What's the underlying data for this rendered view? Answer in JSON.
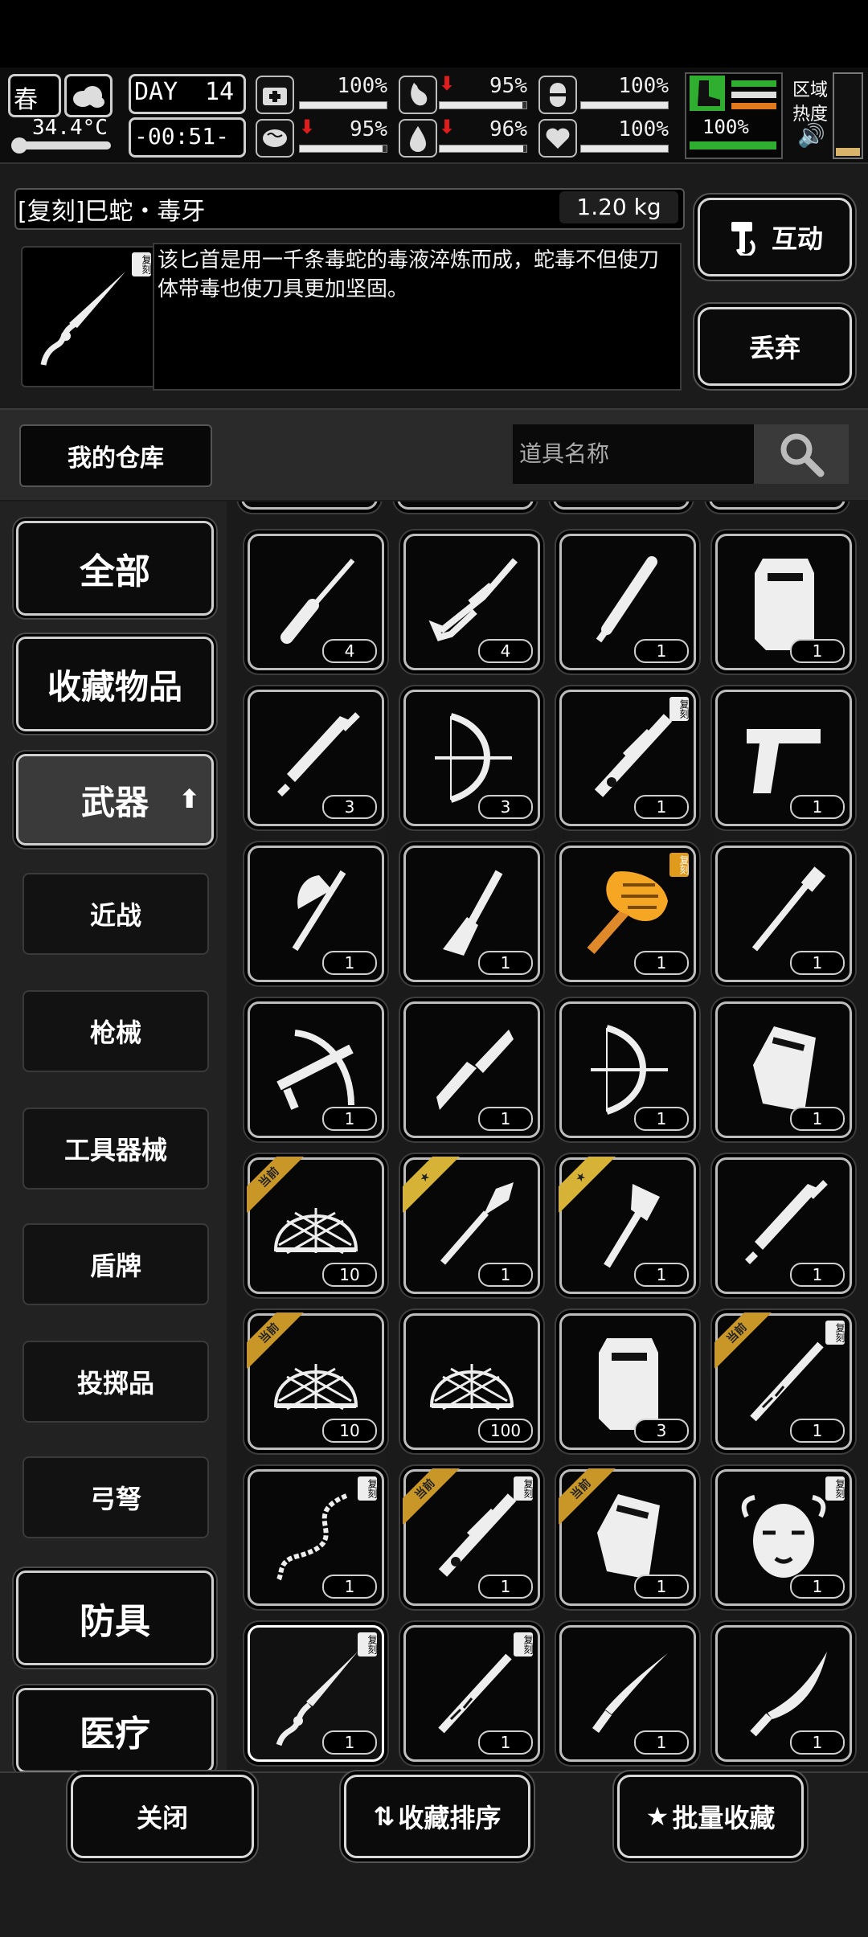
{
  "hud": {
    "season": "春",
    "temperature": "34.4°C",
    "day_label": "DAY",
    "day_number": "14",
    "clock": "-00:51-",
    "zone_heat_label_1": "区域",
    "zone_heat_label_2": "热度",
    "stats": [
      {
        "icon": "medkit-icon",
        "value": "100%",
        "level": 1.0,
        "down": false
      },
      {
        "icon": "stomach-icon",
        "value": "95%",
        "level": 0.95,
        "down": true
      },
      {
        "icon": "pill-icon",
        "value": "100%",
        "level": 1.0,
        "down": false
      },
      {
        "icon": "brain-icon",
        "value": "95%",
        "level": 0.95,
        "down": true
      },
      {
        "icon": "water-drop-icon",
        "value": "96%",
        "level": 0.96,
        "down": true
      },
      {
        "icon": "heart-icon",
        "value": "100%",
        "level": 1.0,
        "down": false
      }
    ],
    "stamina_value": "100%"
  },
  "item": {
    "title": "[复刻]巳蛇・毒牙",
    "weight": "1.20 kg",
    "tag": "复刻",
    "description": "该匕首是用一千条毒蛇的毒液淬炼而成，蛇毒不但使刀体带毒也使刀具更加坚固。"
  },
  "actions": {
    "interact": "互动",
    "discard": "丢弃"
  },
  "warehouse": {
    "tab_label": "我的仓库",
    "search_placeholder": "道具名称"
  },
  "sidebar": {
    "all": "全部",
    "favorites": "收藏物品",
    "weapons": "武器",
    "sub": [
      "近战",
      "枪械",
      "工具器械",
      "盾牌",
      "投掷品",
      "弓弩"
    ],
    "armor": "防具",
    "medical": "医疗"
  },
  "grid": [
    {
      "icon": "screwdriver-icon",
      "count": "4"
    },
    {
      "icon": "sniper-rifle-icon",
      "count": "4"
    },
    {
      "icon": "baton-icon",
      "count": "1"
    },
    {
      "icon": "riot-shield-icon",
      "count": "1"
    },
    {
      "icon": "broadsword-icon",
      "count": "3"
    },
    {
      "icon": "compound-bow-icon",
      "count": "3"
    },
    {
      "icon": "ornate-rifle-icon",
      "count": "1",
      "tag": "复刻"
    },
    {
      "icon": "pistol-icon",
      "count": "1"
    },
    {
      "icon": "axe-icon",
      "count": "1"
    },
    {
      "icon": "spatula-icon",
      "count": "1"
    },
    {
      "icon": "golden-mace-icon",
      "count": "1",
      "tag": "复刻",
      "tag_gold": true
    },
    {
      "icon": "telescopic-baton-icon",
      "count": "1"
    },
    {
      "icon": "crossbow-icon",
      "count": "1"
    },
    {
      "icon": "combat-knife-icon",
      "count": "1"
    },
    {
      "icon": "compound-bow-icon",
      "count": "1"
    },
    {
      "icon": "armored-shield-icon",
      "count": "1"
    },
    {
      "icon": "net-icon",
      "count": "10",
      "ribbon": "当前"
    },
    {
      "icon": "shovel-icon",
      "count": "1",
      "ribbon_star": true
    },
    {
      "icon": "hatchet-icon",
      "count": "1",
      "ribbon_star": true
    },
    {
      "icon": "broadsword-icon",
      "count": "1"
    },
    {
      "icon": "net-icon",
      "count": "10",
      "ribbon": "当前"
    },
    {
      "icon": "net-icon",
      "count": "100"
    },
    {
      "icon": "riot-shield-icon",
      "count": "3"
    },
    {
      "icon": "ornate-sword-icon",
      "count": "1",
      "tag": "复刻",
      "ribbon": "当前"
    },
    {
      "icon": "chain-whip-icon",
      "count": "1",
      "tag": "复刻"
    },
    {
      "icon": "ornate-rifle-icon",
      "count": "1",
      "tag": "复刻",
      "ribbon": "当前"
    },
    {
      "icon": "armored-shield-icon",
      "count": "1",
      "ribbon": "当前"
    },
    {
      "icon": "medusa-mask-icon",
      "count": "1",
      "tag": "复刻"
    },
    {
      "icon": "snake-dagger-icon",
      "count": "1",
      "tag": "复刻",
      "selected": true
    },
    {
      "icon": "ornate-sword-icon",
      "count": "1",
      "tag": "复刻"
    },
    {
      "icon": "machete-icon",
      "count": "1"
    },
    {
      "icon": "kukri-icon",
      "count": "1"
    }
  ],
  "bottom": {
    "close": "关闭",
    "sort_favorites": "收藏排序",
    "batch_favorite": "批量收藏"
  }
}
